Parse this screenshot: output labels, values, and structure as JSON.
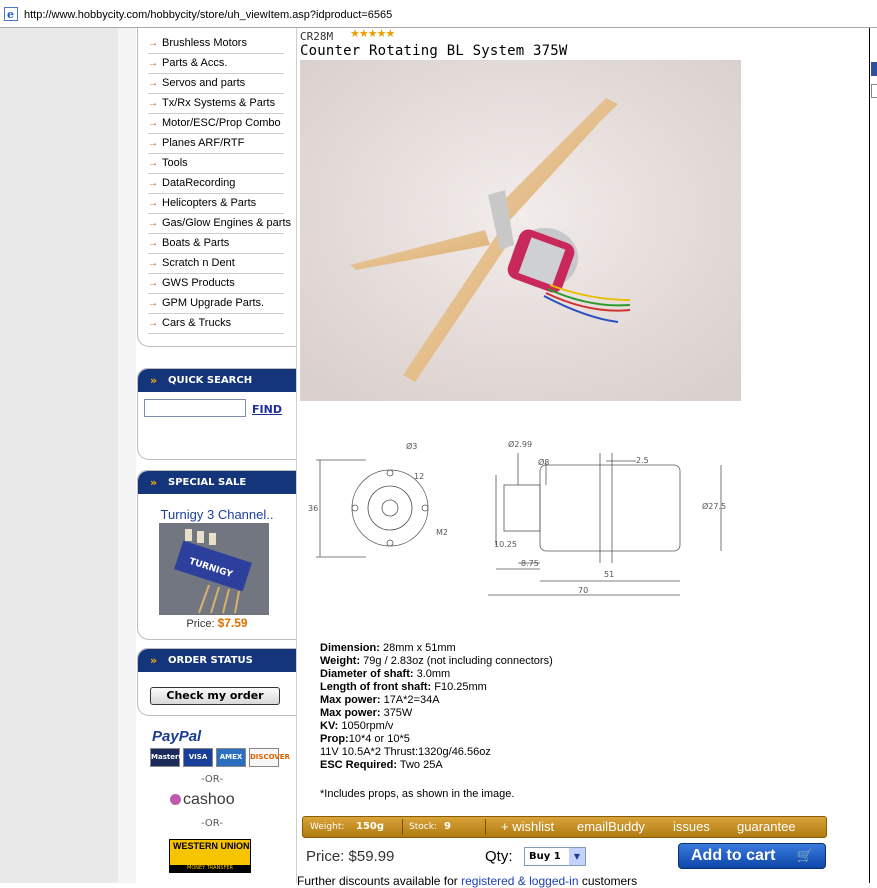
{
  "browser": {
    "url": "http://www.hobbycity.com/hobbycity/store/uh_viewItem.asp?idproduct=6565",
    "icon": "ie-page-icon"
  },
  "sidebar": {
    "categories": [
      "Brushless Motors",
      "Parts & Accs.",
      "Servos and parts",
      "Tx/Rx Systems & Parts",
      "Motor/ESC/Prop Combo",
      "Planes ARF/RTF",
      "Tools",
      "DataRecording",
      "Helicopters & Parts",
      "Gas/Glow Engines & parts",
      "Boats & Parts",
      "Scratch n Dent",
      "GWS Products",
      "GPM Upgrade Parts.",
      "Cars & Trucks"
    ],
    "quick_search": {
      "title": "QUICK SEARCH",
      "button": "FIND",
      "value": ""
    },
    "special_sale": {
      "title": "SPECIAL SALE",
      "product": "Turnigy 3 Channel..",
      "price_label": "Price:",
      "price": "$7.59"
    },
    "order_status": {
      "title": "ORDER STATUS",
      "button": "Check my order"
    },
    "payments": {
      "paypal": "PayPal",
      "cards": [
        "MasterCard",
        "VISA",
        "AMEX",
        "DISCOVER"
      ],
      "or1": "-OR-",
      "cashoo": "cashoo",
      "or2": "-OR-",
      "western_union": "WESTERN UNION",
      "western_union_sub": "MONEY TRANSFER"
    }
  },
  "product": {
    "sku": "CR28M",
    "rating_stars": 5,
    "title": "Counter Rotating BL System 375W",
    "drawing_labels": {
      "d3": "Ø3",
      "twelve": "12",
      "thirtysix": "36",
      "m2": "M2",
      "d299": "Ø2.99",
      "d8": "Ø8",
      "d25": "2.5",
      "d275": "Ø27.5",
      "l1025": "10.25",
      "l875": "8.75",
      "l51": "51",
      "l70": "70"
    },
    "specs": [
      {
        "label": "Dimension:",
        "value": " 28mm x 51mm"
      },
      {
        "label": "Weight:",
        "value": " 79g / 2.83oz  (not including connectors)"
      },
      {
        "label": "Diameter of shaft:",
        "value": " 3.0mm"
      },
      {
        "label": "Length of front shaft:",
        "value": " F10.25mm"
      },
      {
        "label": "Max power:",
        "value": " 17A*2=34A"
      },
      {
        "label": "Max power:",
        "value": " 375W"
      },
      {
        "label": "KV:",
        "value": " 1050rpm/v"
      },
      {
        "label": "Prop:",
        "value": "10*4  or  10*5"
      },
      {
        "label": "",
        "value": "11V 10.5A*2 Thrust:1320g/46.56oz"
      },
      {
        "label": "ESC Required:",
        "value": " Two 25A"
      }
    ],
    "note": "*Includes props, as shown in the image.",
    "infobar": {
      "weight_label": "Weight:",
      "weight": "150g",
      "stock_label": "Stock:",
      "stock": "9",
      "links": [
        "+ wishlist",
        "emailBuddy",
        "issues",
        "guarantee"
      ]
    },
    "price_label": "Price:",
    "price": "$59.99",
    "qty_label": "Qty:",
    "qty_value": "Buy 1",
    "add_to_cart": "Add to cart",
    "further": {
      "prefix": "Further discounts available for ",
      "link": "registered & logged-in",
      "suffix": " customers"
    }
  }
}
